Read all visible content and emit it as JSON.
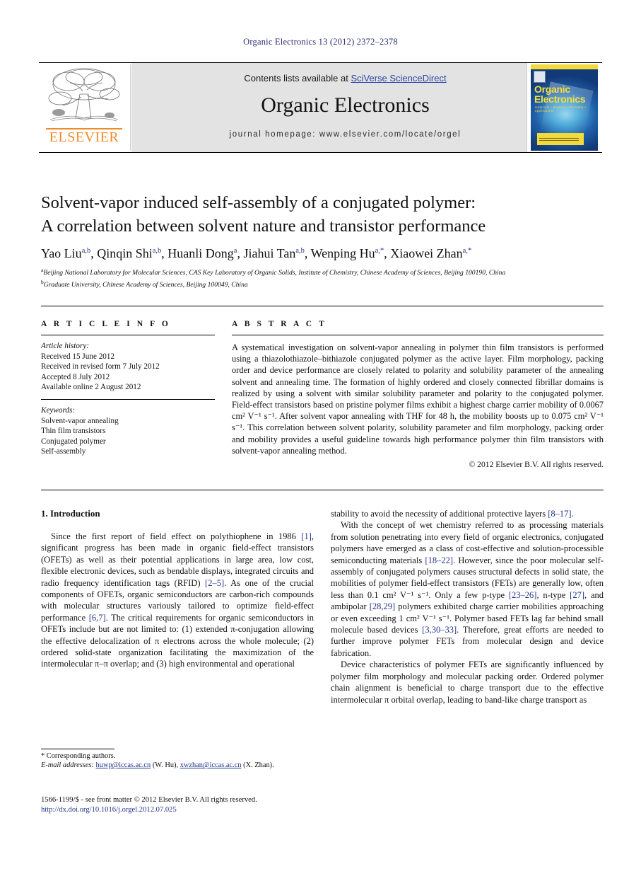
{
  "running_head": "Organic Electronics 13 (2012) 2372–2378",
  "masthead": {
    "contents_prefix": "Contents lists available at ",
    "sciencedirect_link": "SciVerse ScienceDirect",
    "journal_name": "Organic Electronics",
    "homepage": "journal homepage: www.elsevier.com/locate/orgel",
    "publisher_logo_word": "ELSEVIER",
    "cover": {
      "title_line1": "Organic",
      "title_line2": "Electronics",
      "subtitle": "materials • physics • chemistry • applications"
    }
  },
  "article": {
    "title_line1": "Solvent-vapor induced self-assembly of a conjugated polymer:",
    "title_line2": "A correlation between solvent nature and transistor performance",
    "authors": [
      {
        "name": "Yao Liu",
        "marks": "a,b"
      },
      {
        "name": "Qinqin Shi",
        "marks": "a,b"
      },
      {
        "name": "Huanli Dong",
        "marks": "a"
      },
      {
        "name": "Jiahui Tan",
        "marks": "a,b"
      },
      {
        "name": "Wenping Hu",
        "marks": "a,*"
      },
      {
        "name": "Xiaowei Zhan",
        "marks": "a,*"
      }
    ],
    "affiliations": [
      {
        "mark": "a",
        "text": "Beijing National Laboratory for Molecular Sciences, CAS Key Laboratory of Organic Solids, Institute of Chemistry, Chinese Academy of Sciences, Beijing 100190, China"
      },
      {
        "mark": "b",
        "text": "Graduate University, Chinese Academy of Sciences, Beijing 100049, China"
      }
    ]
  },
  "article_info": {
    "kicker": "A R T I C L E    I N F O",
    "history_label": "Article history:",
    "history": [
      "Received 15 June 2012",
      "Received in revised form 7 July 2012",
      "Accepted 8 July 2012",
      "Available online 2 August 2012"
    ],
    "keywords_label": "Keywords:",
    "keywords": [
      "Solvent-vapor annealing",
      "Thin film transistors",
      "Conjugated polymer",
      "Self-assembly"
    ]
  },
  "abstract": {
    "kicker": "A B S T R A C T",
    "text": "A systematical investigation on solvent-vapor annealing in polymer thin film transistors is performed using a thiazolothiazole–bithiazole conjugated polymer as the active layer. Film morphology, packing order and device performance are closely related to polarity and solubility parameter of the annealing solvent and annealing time. The formation of highly ordered and closely connected fibrillar domains is realized by using a solvent with similar solubility parameter and polarity to the conjugated polymer. Field-effect transistors based on pristine polymer films exhibit a highest charge carrier mobility of 0.0067 cm² V⁻¹ s⁻¹. After solvent vapor annealing with THF for 48 h, the mobility boosts up to 0.075 cm² V⁻¹ s⁻¹. This correlation between solvent polarity, solubility parameter and film morphology, packing order and mobility provides a useful guideline towards high performance polymer thin film transistors with solvent-vapor annealing method.",
    "copyright": "© 2012 Elsevier B.V. All rights reserved."
  },
  "body": {
    "section_heading": "1. Introduction",
    "left_paragraphs": [
      "Since the first report of field effect on polythiophene in 1986 [1], significant progress has been made in organic field-effect transistors (OFETs) as well as their potential applications in large area, low cost, flexible electronic devices, such as bendable displays, integrated circuits and radio frequency identification tags (RFID) [2–5]. As one of the crucial components of OFETs, organic semiconductors are carbon-rich compounds with molecular structures variously tailored to optimize field-effect performance [6,7]. The critical requirements for organic semiconductors in OFETs include but are not limited to: (1) extended π-conjugation allowing the effective delocalization of π electrons across the whole molecule; (2) ordered solid-state organization facilitating the maximization of the intermolecular π–π overlap; and (3) high environmental and operational"
    ],
    "right_paragraphs": [
      "stability to avoid the necessity of additional protective layers [8–17].",
      "With the concept of wet chemistry referred to as processing materials from solution penetrating into every field of organic electronics, conjugated polymers have emerged as a class of cost-effective and solution-processible semiconducting materials [18–22]. However, since the poor molecular self-assembly of conjugated polymers causes structural defects in solid state, the mobilities of polymer field-effect transistors (FETs) are generally low, often less than 0.1 cm² V⁻¹ s⁻¹. Only a few p-type [23–26], n-type [27], and ambipolar [28,29] polymers exhibited charge carrier mobilities approaching or even exceeding 1 cm² V⁻¹ s⁻¹. Polymer based FETs lag far behind small molecule based devices [3,30–33]. Therefore, great efforts are needed to further improve polymer FETs from molecular design and device fabrication.",
      "Device characteristics of polymer FETs are significantly influenced by polymer film morphology and molecular packing order. Ordered polymer chain alignment is beneficial to charge transport due to the effective intermolecular π orbital overlap, leading to band-like charge transport as"
    ]
  },
  "footnote": {
    "corresponding": "* Corresponding authors.",
    "email_label": "E-mail addresses:",
    "email_1": "huwp@iccas.ac.cn",
    "email_1_owner": "(W. Hu)",
    "email_2": "xwzhan@iccas.ac.cn",
    "email_2_owner": "(X. Zhan)."
  },
  "imprint": {
    "issn_line": "1566-1199/$ - see front matter © 2012 Elsevier B.V. All rights reserved.",
    "doi_line": "http://dx.doi.org/10.1016/j.orgel.2012.07.025"
  },
  "colors": {
    "link_blue": "#22348a",
    "running_head_blue": "#2d2d7a",
    "elsevier_orange": "#f08a24",
    "masthead_gray": "#e3e3e3",
    "cover_yellow": "#f2d93c"
  }
}
